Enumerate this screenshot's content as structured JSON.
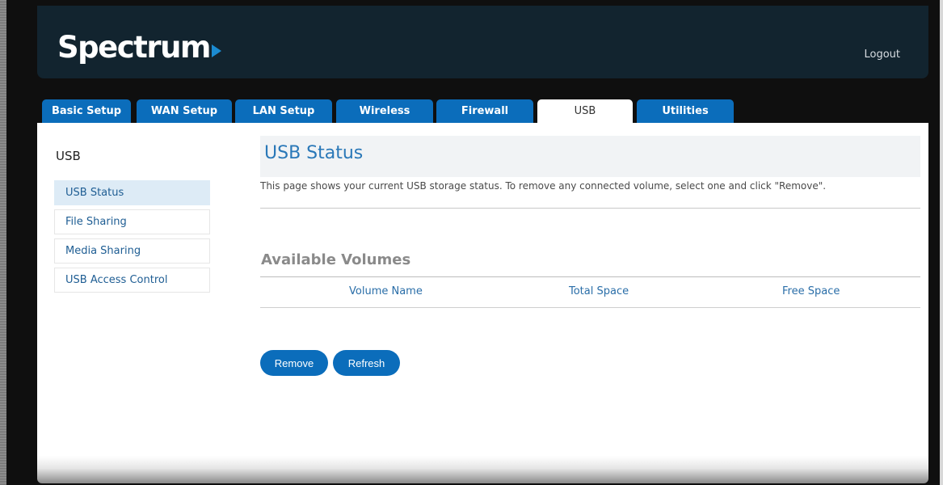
{
  "header": {
    "logo_text": "Spectrum",
    "logout_label": "Logout"
  },
  "tabs": [
    {
      "label": "Basic Setup",
      "active": false
    },
    {
      "label": "WAN Setup",
      "active": false
    },
    {
      "label": "LAN Setup",
      "active": false
    },
    {
      "label": "Wireless",
      "active": false
    },
    {
      "label": "Firewall",
      "active": false
    },
    {
      "label": "USB",
      "active": true
    },
    {
      "label": "Utilities",
      "active": false
    }
  ],
  "sidebar": {
    "title": "USB",
    "items": [
      {
        "label": "USB Status",
        "active": true
      },
      {
        "label": "File Sharing",
        "active": false
      },
      {
        "label": "Media Sharing",
        "active": false
      },
      {
        "label": "USB Access Control",
        "active": false
      }
    ]
  },
  "main": {
    "title": "USB Status",
    "description": "This page shows your current USB storage status. To remove any connected volume, select one and click \"Remove\".",
    "section_title": "Available Volumes",
    "columns": [
      "Volume Name",
      "Total Space",
      "Free Space"
    ],
    "buttons": {
      "remove": "Remove",
      "refresh": "Refresh"
    }
  },
  "colors": {
    "brand_blue": "#0b6dbb",
    "header_bg": "#12242f",
    "title_blue": "#2a78b8"
  }
}
